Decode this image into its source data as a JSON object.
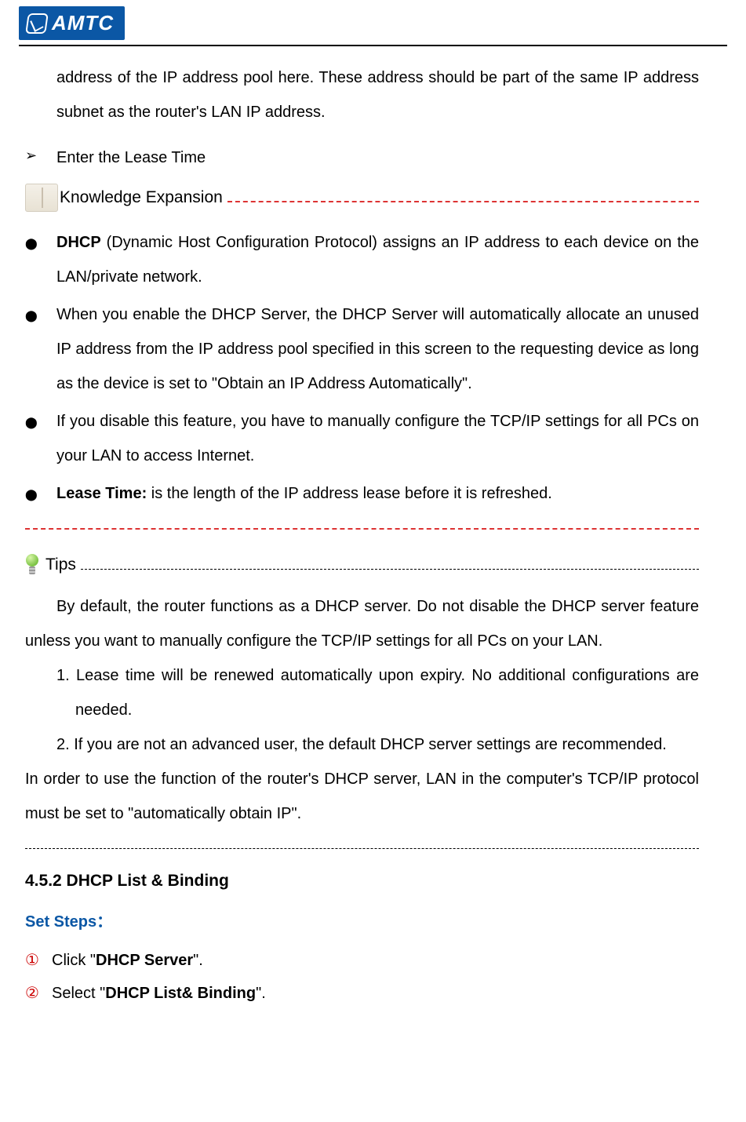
{
  "logo": {
    "text": "AMTC"
  },
  "intro_paragraph": "address of the IP address pool here. These address should be part of the same IP address subnet as the router's LAN IP address.",
  "arrow_item": "Enter the Lease Time",
  "knowledge": {
    "title": "Knowledge Expansion",
    "items": [
      {
        "bold_prefix": "DHCP",
        "rest": " (Dynamic Host Configuration Protocol) assigns an IP address to each device on the LAN/private network."
      },
      {
        "bold_prefix": "",
        "rest": "When you enable the DHCP Server, the DHCP Server will automatically allocate an unused IP address from the IP address pool specified in this screen to the requesting device as long as the device is set to \"Obtain an IP Address Automatically\"."
      },
      {
        "bold_prefix": "",
        "rest": "If you disable this feature, you have to manually configure the TCP/IP settings for all PCs on your LAN to access Internet."
      },
      {
        "bold_prefix": "Lease Time:",
        "rest": " is the length of the IP address lease before it is refreshed."
      }
    ]
  },
  "tips": {
    "title": "Tips",
    "para1": "By default, the router functions as a DHCP server. Do not disable the DHCP server feature unless you want to manually configure the TCP/IP settings for all PCs on your LAN.",
    "list": [
      "1. Lease time will be renewed automatically upon expiry. No additional configurations are needed.",
      "2. If you are not an advanced user, the default DHCP server settings are recommended."
    ],
    "para2": "In order to use the function of the router's DHCP server, LAN in the computer's TCP/IP protocol must be set to \"automatically obtain IP\"."
  },
  "section452": {
    "heading": "4.5.2 DHCP List & Binding",
    "setsteps": "Set Steps：",
    "steps": [
      {
        "num": "①",
        "pre": "Click \"",
        "bold": "DHCP Server",
        "post": "\"."
      },
      {
        "num": "②",
        "pre": "Select \"",
        "bold": "DHCP List& Binding",
        "post": "\"."
      }
    ]
  }
}
